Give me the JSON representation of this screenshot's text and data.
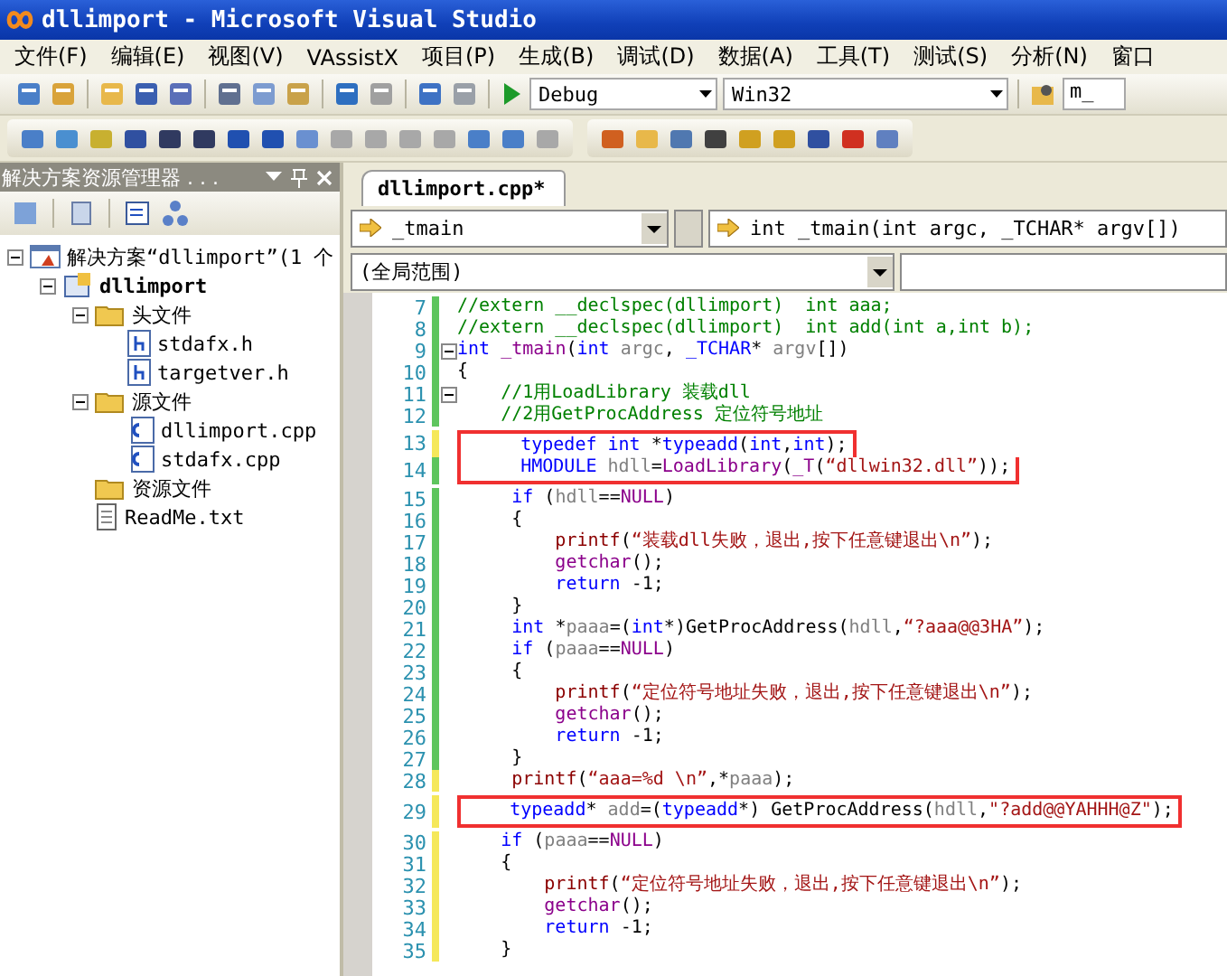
{
  "window": {
    "title": "dllimport - Microsoft Visual Studio"
  },
  "menu": [
    "文件(F)",
    "编辑(E)",
    "视图(V)",
    "VAssistX",
    "项目(P)",
    "生成(B)",
    "调试(D)",
    "数据(A)",
    "工具(T)",
    "测试(S)",
    "分析(N)",
    "窗口"
  ],
  "toolbar": {
    "configuration": "Debug",
    "platform": "Win32",
    "find_field": "m_"
  },
  "solution_explorer": {
    "title": "解决方案资源管理器 . . .",
    "tree": [
      {
        "label": "解决方案“dllimport”(1 个",
        "kind": "solution",
        "expanded": true,
        "children": [
          {
            "label": "dllimport",
            "kind": "project",
            "expanded": true,
            "children": [
              {
                "label": "头文件",
                "kind": "folder",
                "expanded": true,
                "children": [
                  {
                    "label": "stdafx.h",
                    "kind": "header"
                  },
                  {
                    "label": "targetver.h",
                    "kind": "header"
                  }
                ]
              },
              {
                "label": "源文件",
                "kind": "folder",
                "expanded": true,
                "children": [
                  {
                    "label": "dllimport.cpp",
                    "kind": "cpp"
                  },
                  {
                    "label": "stdafx.cpp",
                    "kind": "cpp"
                  }
                ]
              },
              {
                "label": "资源文件",
                "kind": "folder"
              },
              {
                "label": "ReadMe.txt",
                "kind": "text"
              }
            ]
          }
        ]
      }
    ]
  },
  "editor": {
    "tabs": [
      {
        "label": "dllimport.cpp*",
        "selected": true
      }
    ],
    "member_dropdown": "_tmain",
    "signature_dropdown": "int _tmain(int argc, _TCHAR* argv[])",
    "scope_dropdown": "(全局范围)",
    "lines": [
      {
        "number": "7",
        "saved": true,
        "boxed": false,
        "fold": false,
        "tokens": [
          {
            "kind": "cm",
            "text": "//extern __declspec(dllimport)  int aaa;"
          }
        ]
      },
      {
        "number": "8",
        "saved": true,
        "boxed": false,
        "fold": false,
        "tokens": [
          {
            "kind": "cm",
            "text": "//extern __declspec(dllimport)  int add(int a,int b);"
          }
        ]
      },
      {
        "number": "9",
        "saved": true,
        "boxed": false,
        "fold": true,
        "tokens": [
          {
            "kind": "kw",
            "text": "int "
          },
          {
            "kind": "fn",
            "text": "_tmain"
          },
          {
            "kind": "pl",
            "text": "("
          },
          {
            "kind": "kw",
            "text": "int"
          },
          {
            "kind": "id",
            "text": " argc"
          },
          {
            "kind": "pl",
            "text": ", "
          },
          {
            "kind": "kw",
            "text": "_TCHAR"
          },
          {
            "kind": "pl",
            "text": "*"
          },
          {
            "kind": "id",
            "text": " argv"
          },
          {
            "kind": "pl",
            "text": "[])"
          }
        ]
      },
      {
        "number": "10",
        "saved": true,
        "boxed": false,
        "fold": false,
        "tokens": [
          {
            "kind": "pl",
            "text": "{"
          }
        ]
      },
      {
        "number": "11",
        "saved": true,
        "boxed": false,
        "fold": true,
        "tokens": [
          {
            "kind": "cm",
            "text": "    //1用LoadLibrary 装载dll"
          }
        ]
      },
      {
        "number": "12",
        "saved": true,
        "boxed": false,
        "fold": false,
        "tokens": [
          {
            "kind": "cm",
            "text": "    //2用GetProcAddress 定位符号地址"
          }
        ]
      },
      {
        "number": "13",
        "saved": false,
        "boxed": true,
        "fold": false,
        "tokens": [
          {
            "kind": "kw",
            "text": "     typedef int "
          },
          {
            "kind": "pl",
            "text": "*"
          },
          {
            "kind": "kw",
            "text": "typeadd"
          },
          {
            "kind": "pl",
            "text": "("
          },
          {
            "kind": "kw",
            "text": "int"
          },
          {
            "kind": "pl",
            "text": ","
          },
          {
            "kind": "kw",
            "text": "int"
          },
          {
            "kind": "pl",
            "text": ");"
          }
        ]
      },
      {
        "number": "14",
        "saved": true,
        "boxed": true,
        "fold": false,
        "tokens": [
          {
            "kind": "kw",
            "text": "     HMODULE"
          },
          {
            "kind": "id",
            "text": " hdll"
          },
          {
            "kind": "pl",
            "text": "="
          },
          {
            "kind": "fn",
            "text": "LoadLibrary"
          },
          {
            "kind": "pl",
            "text": "("
          },
          {
            "kind": "fn",
            "text": "_T"
          },
          {
            "kind": "pl",
            "text": "("
          },
          {
            "kind": "str",
            "text": "“dllwin32.dll”"
          },
          {
            "kind": "pl",
            "text": "));"
          }
        ]
      },
      {
        "number": "15",
        "saved": true,
        "boxed": false,
        "fold": false,
        "tokens": [
          {
            "kind": "kw",
            "text": "     if"
          },
          {
            "kind": "pl",
            "text": " ("
          },
          {
            "kind": "id",
            "text": "hdll"
          },
          {
            "kind": "pl",
            "text": "=="
          },
          {
            "kind": "fn",
            "text": "NULL"
          },
          {
            "kind": "pl",
            "text": ")"
          }
        ]
      },
      {
        "number": "16",
        "saved": true,
        "boxed": false,
        "fold": false,
        "tokens": [
          {
            "kind": "pl",
            "text": "     {"
          }
        ]
      },
      {
        "number": "17",
        "saved": true,
        "boxed": false,
        "fold": false,
        "tokens": [
          {
            "kind": "st",
            "text": "         printf"
          },
          {
            "kind": "pl",
            "text": "("
          },
          {
            "kind": "str",
            "text": "“装载dll失败，退出,按下任意键退出\\n”"
          },
          {
            "kind": "pl",
            "text": ");"
          }
        ]
      },
      {
        "number": "18",
        "saved": true,
        "boxed": false,
        "fold": false,
        "tokens": [
          {
            "kind": "fn",
            "text": "         getchar"
          },
          {
            "kind": "pl",
            "text": "();"
          }
        ]
      },
      {
        "number": "19",
        "saved": true,
        "boxed": false,
        "fold": false,
        "tokens": [
          {
            "kind": "kw",
            "text": "         return"
          },
          {
            "kind": "pl",
            "text": " -1;"
          }
        ]
      },
      {
        "number": "20",
        "saved": true,
        "boxed": false,
        "fold": false,
        "tokens": [
          {
            "kind": "pl",
            "text": "     }"
          }
        ]
      },
      {
        "number": "21",
        "saved": true,
        "boxed": false,
        "fold": false,
        "tokens": [
          {
            "kind": "kw",
            "text": "     int"
          },
          {
            "kind": "pl",
            "text": " *"
          },
          {
            "kind": "id",
            "text": "paaa"
          },
          {
            "kind": "pl",
            "text": "=("
          },
          {
            "kind": "kw",
            "text": "int"
          },
          {
            "kind": "pl",
            "text": "*)GetProcAddress("
          },
          {
            "kind": "id",
            "text": "hdll"
          },
          {
            "kind": "pl",
            "text": ","
          },
          {
            "kind": "str",
            "text": "“?aaa@@3HA”"
          },
          {
            "kind": "pl",
            "text": ");"
          }
        ]
      },
      {
        "number": "22",
        "saved": true,
        "boxed": false,
        "fold": false,
        "tokens": [
          {
            "kind": "kw",
            "text": "     if"
          },
          {
            "kind": "pl",
            "text": " ("
          },
          {
            "kind": "id",
            "text": "paaa"
          },
          {
            "kind": "pl",
            "text": "=="
          },
          {
            "kind": "fn",
            "text": "NULL"
          },
          {
            "kind": "pl",
            "text": ")"
          }
        ]
      },
      {
        "number": "23",
        "saved": true,
        "boxed": false,
        "fold": false,
        "tokens": [
          {
            "kind": "pl",
            "text": "     {"
          }
        ]
      },
      {
        "number": "24",
        "saved": true,
        "boxed": false,
        "fold": false,
        "tokens": [
          {
            "kind": "st",
            "text": "         printf"
          },
          {
            "kind": "pl",
            "text": "("
          },
          {
            "kind": "str",
            "text": "“定位符号地址失败，退出,按下任意键退出\\n”"
          },
          {
            "kind": "pl",
            "text": ");"
          }
        ]
      },
      {
        "number": "25",
        "saved": true,
        "boxed": false,
        "fold": false,
        "tokens": [
          {
            "kind": "fn",
            "text": "         getchar"
          },
          {
            "kind": "pl",
            "text": "();"
          }
        ]
      },
      {
        "number": "26",
        "saved": true,
        "boxed": false,
        "fold": false,
        "tokens": [
          {
            "kind": "kw",
            "text": "         return"
          },
          {
            "kind": "pl",
            "text": " -1;"
          }
        ]
      },
      {
        "number": "27",
        "saved": true,
        "boxed": false,
        "fold": false,
        "tokens": [
          {
            "kind": "pl",
            "text": "     }"
          }
        ]
      },
      {
        "number": "28",
        "saved": false,
        "boxed": false,
        "fold": false,
        "tokens": [
          {
            "kind": "st",
            "text": "     printf"
          },
          {
            "kind": "pl",
            "text": "("
          },
          {
            "kind": "str",
            "text": "“aaa=%d \\n”"
          },
          {
            "kind": "pl",
            "text": ",*"
          },
          {
            "kind": "id",
            "text": "paaa"
          },
          {
            "kind": "pl",
            "text": ");"
          }
        ]
      },
      {
        "number": "29",
        "saved": false,
        "boxed": true,
        "fold": false,
        "tokens": [
          {
            "kind": "kw",
            "text": "    typeadd"
          },
          {
            "kind": "pl",
            "text": "* "
          },
          {
            "kind": "id",
            "text": "add"
          },
          {
            "kind": "pl",
            "text": "=("
          },
          {
            "kind": "kw",
            "text": "typeadd"
          },
          {
            "kind": "pl",
            "text": "*) GetProcAddress("
          },
          {
            "kind": "id",
            "text": "hdll"
          },
          {
            "kind": "pl",
            "text": ","
          },
          {
            "kind": "str",
            "text": "\"?add@@YAHHH@Z\""
          },
          {
            "kind": "pl",
            "text": ");"
          }
        ]
      },
      {
        "number": "30",
        "saved": false,
        "boxed": false,
        "fold": false,
        "tokens": [
          {
            "kind": "kw",
            "text": "    if"
          },
          {
            "kind": "pl",
            "text": " ("
          },
          {
            "kind": "id",
            "text": "paaa"
          },
          {
            "kind": "pl",
            "text": "=="
          },
          {
            "kind": "fn",
            "text": "NULL"
          },
          {
            "kind": "pl",
            "text": ")"
          }
        ]
      },
      {
        "number": "31",
        "saved": false,
        "boxed": false,
        "fold": false,
        "tokens": [
          {
            "kind": "pl",
            "text": "    {"
          }
        ]
      },
      {
        "number": "32",
        "saved": false,
        "boxed": false,
        "fold": false,
        "tokens": [
          {
            "kind": "st",
            "text": "        printf"
          },
          {
            "kind": "pl",
            "text": "("
          },
          {
            "kind": "str",
            "text": "“定位符号地址失败，退出,按下任意键退出\\n”"
          },
          {
            "kind": "pl",
            "text": ");"
          }
        ]
      },
      {
        "number": "33",
        "saved": false,
        "boxed": false,
        "fold": false,
        "tokens": [
          {
            "kind": "fn",
            "text": "        getchar"
          },
          {
            "kind": "pl",
            "text": "();"
          }
        ]
      },
      {
        "number": "34",
        "saved": false,
        "boxed": false,
        "fold": false,
        "tokens": [
          {
            "kind": "kw",
            "text": "        return"
          },
          {
            "kind": "pl",
            "text": " -1;"
          }
        ]
      },
      {
        "number": "35",
        "saved": false,
        "boxed": false,
        "fold": false,
        "tokens": [
          {
            "kind": "pl",
            "text": "    }"
          }
        ]
      }
    ]
  }
}
